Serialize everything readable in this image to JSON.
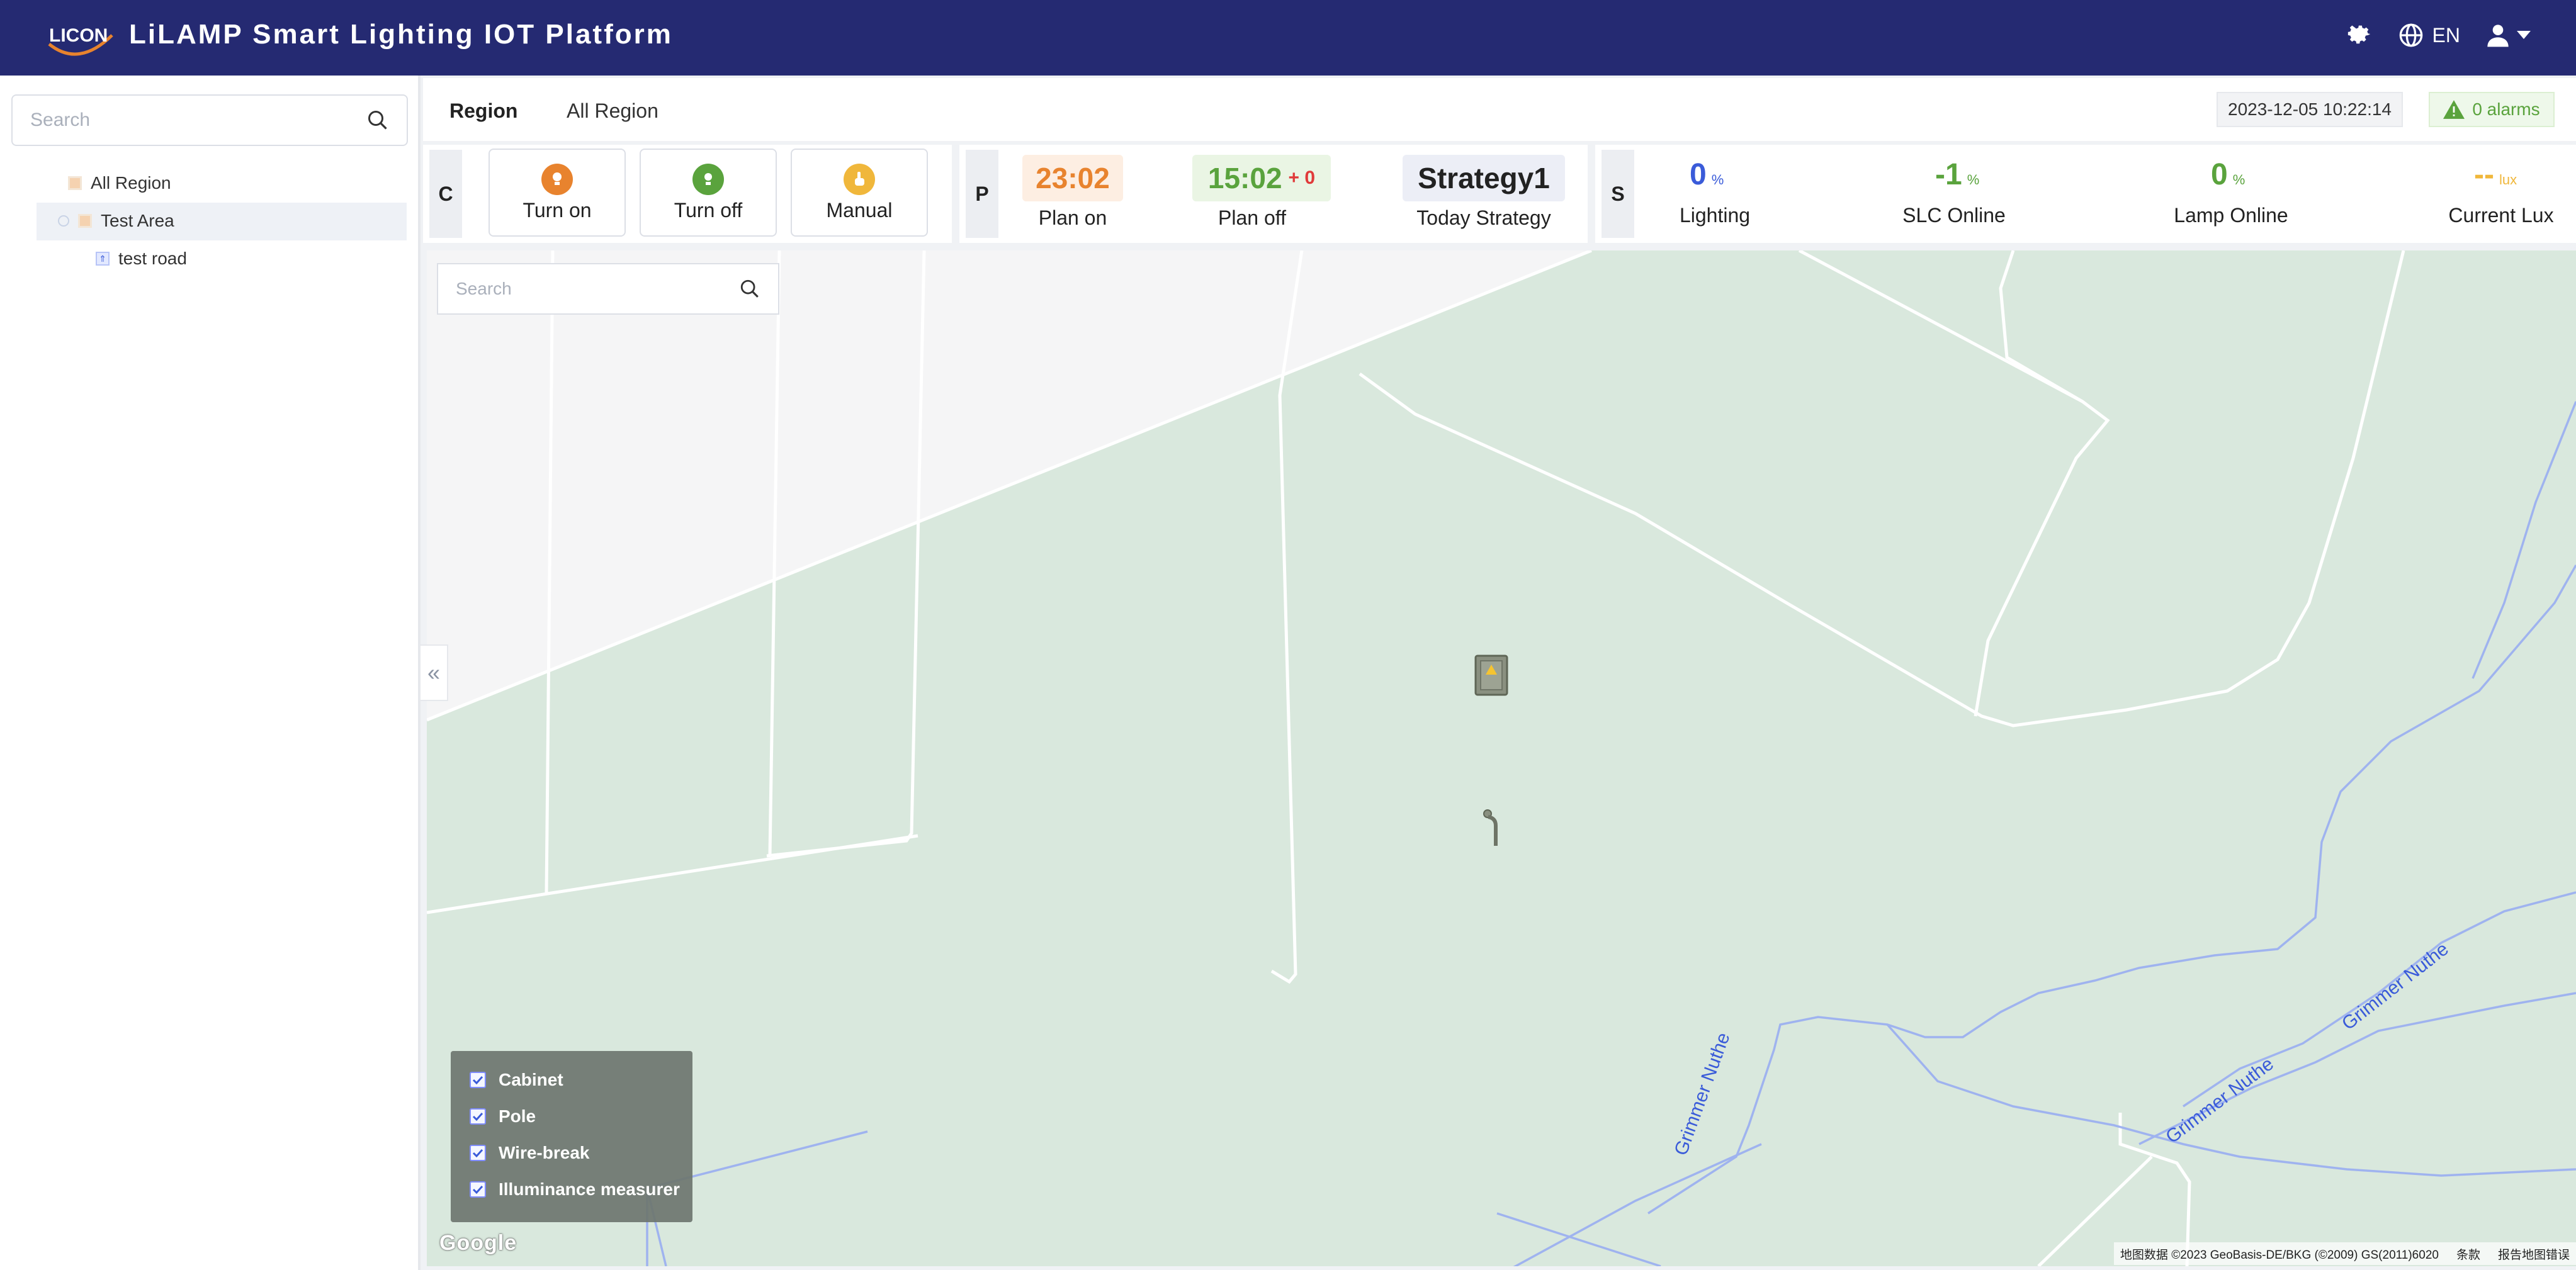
{
  "app": {
    "title": "LiLAMP Smart Lighting IOT Platform",
    "logo_text": "LICON"
  },
  "topbar": {
    "language": "EN"
  },
  "sidebar": {
    "search_placeholder": "Search",
    "tree": [
      {
        "label": "All Region"
      },
      {
        "label": "Test Area"
      },
      {
        "label": "test road"
      }
    ]
  },
  "header": {
    "region_label": "Region",
    "region_value": "All Region",
    "datetime": "2023-12-05 10:22:14",
    "alarms": "0 alarms"
  },
  "control": {
    "tag": "C",
    "buttons": [
      {
        "label": "Turn on",
        "color": "#e8832e"
      },
      {
        "label": "Turn off",
        "color": "#5aa33d"
      },
      {
        "label": "Manual",
        "color": "#f0b73b"
      }
    ]
  },
  "plan": {
    "tag": "P",
    "plan_on_time": "23:02",
    "plan_on_label": "Plan on",
    "plan_off_time": "15:02",
    "plan_off_offset": "+ 0",
    "plan_off_label": "Plan off",
    "strategy_name": "Strategy1",
    "strategy_label": "Today Strategy"
  },
  "stats": {
    "tag": "S",
    "items": [
      {
        "value": "0",
        "unit": "%",
        "label": "Lighting",
        "color": "#3a5bd9"
      },
      {
        "value": "-1",
        "unit": "%",
        "label": "SLC Online",
        "color": "#5aa33d"
      },
      {
        "value": "0",
        "unit": "%",
        "label": "Lamp Online",
        "color": "#5aa33d"
      },
      {
        "value": "--",
        "unit": "lux",
        "label": "Current Lux",
        "color": "#f0b73b"
      }
    ]
  },
  "map": {
    "search_placeholder": "Search",
    "layers": [
      {
        "label": "Cabinet",
        "checked": true
      },
      {
        "label": "Pole",
        "checked": true
      },
      {
        "label": "Wire-break",
        "checked": true
      },
      {
        "label": "Illuminance measurer",
        "checked": true
      }
    ],
    "labels": [
      "Grimmer Nuthe",
      "Grimmer Nuthe",
      "Grimmer Nuthe"
    ],
    "google_logo": "Google",
    "attribution": "地图数据 ©2023 GeoBasis-DE/BKG (©2009) GS(2011)6020",
    "terms": "条款",
    "report": "报告地图错误"
  }
}
